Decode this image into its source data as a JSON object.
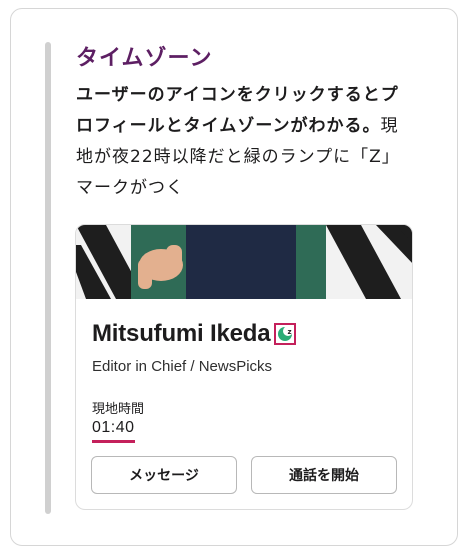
{
  "section": {
    "title": "タイムゾーン",
    "desc_bold": "ユーザーのアイコンをクリックするとプロフィールとタイムゾーンがわかる。",
    "desc_regular": "現地が夜22時以降だと緑のランプに「Z」マークがつく"
  },
  "profile": {
    "name": "Mitsufumi Ikeda",
    "job_title": "Editor in Chief / NewsPicks",
    "local_time_label": "現地時間",
    "local_time": "01:40",
    "badge_icon": "snooze-status-icon",
    "badge_letter": "z",
    "badge_color": "#2bac76",
    "highlight_color": "#c4205b"
  },
  "buttons": {
    "message": "メッセージ",
    "start_call": "通話を開始"
  },
  "colors": {
    "title": "#5d1f63",
    "accent_bar": "#d0d0d0"
  }
}
